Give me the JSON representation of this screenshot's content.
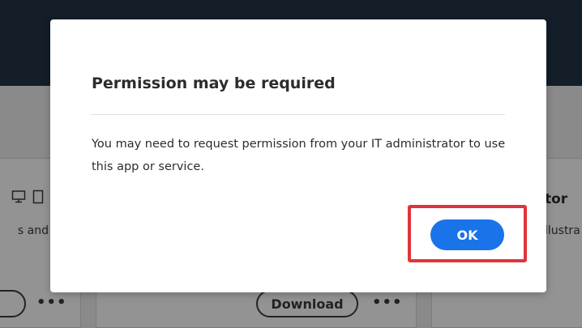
{
  "background": {
    "cards": [
      {
        "description_text": "s and",
        "buttons": [],
        "more_label": "•••"
      },
      {
        "download_label": "Download",
        "more_label": "•••"
      },
      {
        "title_fragment": "tor",
        "description_fragment": "llustra"
      }
    ]
  },
  "dialog": {
    "title": "Permission may be required",
    "message": "You may need to request permission from your IT administrator to use this app or service.",
    "ok_label": "OK"
  },
  "colors": {
    "primary_button": "#1a73e8",
    "highlight": "#e0343b",
    "topbar": "#131e29"
  },
  "icons": [
    "desktop-icon",
    "tablet-icon"
  ]
}
